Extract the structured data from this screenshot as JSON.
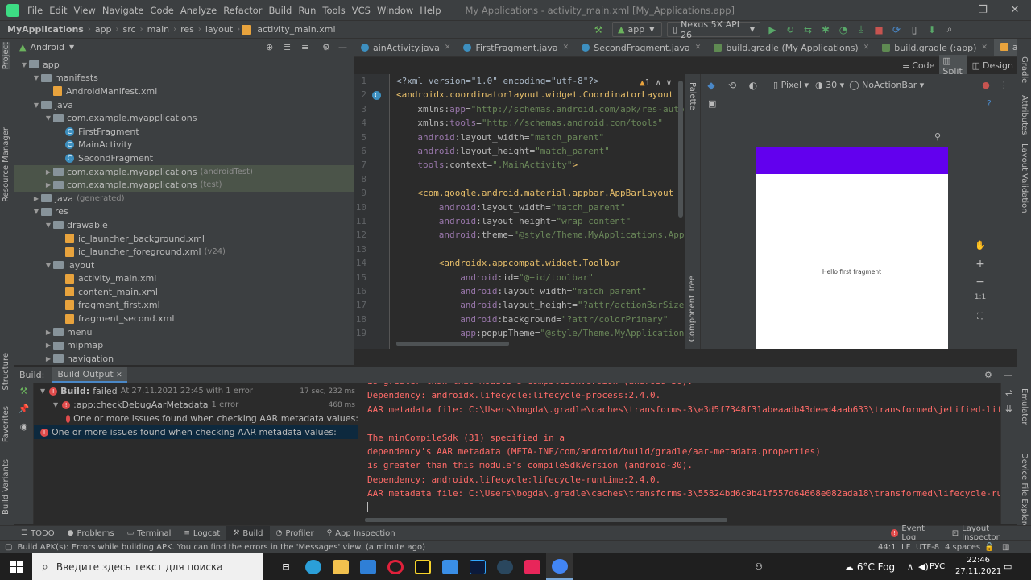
{
  "window": {
    "menu": [
      "File",
      "Edit",
      "View",
      "Navigate",
      "Code",
      "Analyze",
      "Refactor",
      "Build",
      "Run",
      "Tools",
      "VCS",
      "Window",
      "Help"
    ],
    "title": "My Applications - activity_main.xml [My_Applications.app]",
    "controls": {
      "minimize": "—",
      "maximize": "❐",
      "close": "✕"
    }
  },
  "navbar": {
    "breadcrumbs": [
      "MyApplications",
      "app",
      "src",
      "main",
      "res",
      "layout",
      "activity_main.xml"
    ],
    "run_config": "app",
    "device": "Nexus 5X API 26"
  },
  "project": {
    "view_label": "Android",
    "tree": [
      {
        "label": "app",
        "depth": 0,
        "kind": "folder",
        "open": true
      },
      {
        "label": "manifests",
        "depth": 1,
        "kind": "folder",
        "open": true
      },
      {
        "label": "AndroidManifest.xml",
        "depth": 2,
        "kind": "xml"
      },
      {
        "label": "java",
        "depth": 1,
        "kind": "folder",
        "open": true
      },
      {
        "label": "com.example.myapplications",
        "depth": 2,
        "kind": "folder",
        "open": true
      },
      {
        "label": "FirstFragment",
        "depth": 3,
        "kind": "class"
      },
      {
        "label": "MainActivity",
        "depth": 3,
        "kind": "class"
      },
      {
        "label": "SecondFragment",
        "depth": 3,
        "kind": "class"
      },
      {
        "label": "com.example.myapplications",
        "suffix": "(androidTest)",
        "depth": 2,
        "kind": "folder",
        "open": false,
        "hl": true
      },
      {
        "label": "com.example.myapplications",
        "suffix": "(test)",
        "depth": 2,
        "kind": "folder",
        "open": false,
        "hl": true
      },
      {
        "label": "java",
        "suffix": "(generated)",
        "depth": 1,
        "kind": "folder",
        "open": false
      },
      {
        "label": "res",
        "depth": 1,
        "kind": "folder",
        "open": true
      },
      {
        "label": "drawable",
        "depth": 2,
        "kind": "folder",
        "open": true
      },
      {
        "label": "ic_launcher_background.xml",
        "depth": 3,
        "kind": "xml"
      },
      {
        "label": "ic_launcher_foreground.xml",
        "suffix": "(v24)",
        "depth": 3,
        "kind": "xml"
      },
      {
        "label": "layout",
        "depth": 2,
        "kind": "folder",
        "open": true
      },
      {
        "label": "activity_main.xml",
        "depth": 3,
        "kind": "xml"
      },
      {
        "label": "content_main.xml",
        "depth": 3,
        "kind": "xml"
      },
      {
        "label": "fragment_first.xml",
        "depth": 3,
        "kind": "xml"
      },
      {
        "label": "fragment_second.xml",
        "depth": 3,
        "kind": "xml"
      },
      {
        "label": "menu",
        "depth": 2,
        "kind": "folder",
        "open": false
      },
      {
        "label": "mipmap",
        "depth": 2,
        "kind": "folder",
        "open": false
      },
      {
        "label": "navigation",
        "depth": 2,
        "kind": "folder",
        "open": false
      }
    ]
  },
  "editor": {
    "tabs": [
      {
        "label": "ainActivity.java",
        "icon": "class"
      },
      {
        "label": "FirstFragment.java",
        "icon": "class"
      },
      {
        "label": "SecondFragment.java",
        "icon": "class"
      },
      {
        "label": "build.gradle (My Applications)",
        "icon": "gradle"
      },
      {
        "label": "build.gradle (:app)",
        "icon": "gradle"
      },
      {
        "label": "activity_main.xml",
        "icon": "xml",
        "active": true
      },
      {
        "label": "con",
        "icon": "xml"
      }
    ],
    "view_modes": [
      "Code",
      "Split",
      "Design"
    ],
    "warning_count": "1",
    "lines": [
      {
        "n": "1",
        "indent": 0,
        "parts": [
          [
            "pl",
            "<?xml version=\"1.0\" encoding=\"utf-8\"?>"
          ]
        ]
      },
      {
        "n": "2",
        "indent": 0,
        "parts": [
          [
            "tag",
            "<androidx.coordinatorlayout.widget.CoordinatorLayout"
          ]
        ]
      },
      {
        "n": "3",
        "indent": 4,
        "parts": [
          [
            "attr",
            "xmlns:"
          ],
          [
            "ns",
            "app"
          ],
          [
            "attr",
            "="
          ],
          [
            "str",
            "\"http://schemas.android.com/apk/res-auto\""
          ]
        ]
      },
      {
        "n": "4",
        "indent": 4,
        "parts": [
          [
            "attr",
            "xmlns:"
          ],
          [
            "ns",
            "tools"
          ],
          [
            "attr",
            "="
          ],
          [
            "str",
            "\"http://schemas.android.com/tools\""
          ]
        ]
      },
      {
        "n": "5",
        "indent": 4,
        "parts": [
          [
            "ns",
            "android"
          ],
          [
            "attr",
            ":layout_width="
          ],
          [
            "str",
            "\"match_parent\""
          ]
        ]
      },
      {
        "n": "6",
        "indent": 4,
        "parts": [
          [
            "ns",
            "android"
          ],
          [
            "attr",
            ":layout_height="
          ],
          [
            "str",
            "\"match_parent\""
          ]
        ]
      },
      {
        "n": "7",
        "indent": 4,
        "parts": [
          [
            "ns",
            "tools"
          ],
          [
            "attr",
            ":context="
          ],
          [
            "str",
            "\".MainActivity\""
          ],
          [
            "tag",
            ">"
          ]
        ]
      },
      {
        "n": "8",
        "indent": 0,
        "parts": []
      },
      {
        "n": "9",
        "indent": 4,
        "parts": [
          [
            "tag",
            "<com.google.android.material.appbar.AppBarLayout"
          ]
        ]
      },
      {
        "n": "10",
        "indent": 8,
        "parts": [
          [
            "ns",
            "android"
          ],
          [
            "attr",
            ":layout_width="
          ],
          [
            "str",
            "\"match_parent\""
          ]
        ]
      },
      {
        "n": "11",
        "indent": 8,
        "parts": [
          [
            "ns",
            "android"
          ],
          [
            "attr",
            ":layout_height="
          ],
          [
            "str",
            "\"wrap_content\""
          ]
        ]
      },
      {
        "n": "12",
        "indent": 8,
        "parts": [
          [
            "ns",
            "android"
          ],
          [
            "attr",
            ":theme="
          ],
          [
            "str",
            "\"@style/Theme.MyApplications.AppBarOverlay\""
          ],
          [
            "tag",
            ">"
          ]
        ]
      },
      {
        "n": "13",
        "indent": 0,
        "parts": []
      },
      {
        "n": "14",
        "indent": 8,
        "parts": [
          [
            "tag",
            "<androidx.appcompat.widget.Toolbar"
          ]
        ]
      },
      {
        "n": "15",
        "indent": 12,
        "parts": [
          [
            "ns",
            "android"
          ],
          [
            "attr",
            ":id="
          ],
          [
            "str",
            "\"@+id/toolbar\""
          ]
        ]
      },
      {
        "n": "16",
        "indent": 12,
        "parts": [
          [
            "ns",
            "android"
          ],
          [
            "attr",
            ":layout_width="
          ],
          [
            "str",
            "\"match_parent\""
          ]
        ]
      },
      {
        "n": "17",
        "indent": 12,
        "parts": [
          [
            "ns",
            "android"
          ],
          [
            "attr",
            ":layout_height="
          ],
          [
            "str",
            "\"?attr/actionBarSize\""
          ]
        ]
      },
      {
        "n": "18",
        "indent": 12,
        "parts": [
          [
            "ns",
            "android"
          ],
          [
            "attr",
            ":background="
          ],
          [
            "str",
            "\"?attr/colorPrimary\""
          ]
        ]
      },
      {
        "n": "19",
        "indent": 12,
        "parts": [
          [
            "ns",
            "app"
          ],
          [
            "attr",
            ":popupTheme="
          ],
          [
            "str",
            "\"@style/Theme.MyApplications.PopupOverlay\""
          ]
        ]
      }
    ]
  },
  "design": {
    "device": "Pixel",
    "api": "30",
    "theme": "NoActionBar",
    "preview_text": "Hello first fragment",
    "palette_label": "Palette",
    "component_tree_label": "Component Tree",
    "appbar_color": "#6200ee"
  },
  "right_strip": [
    "Gradle",
    "Attributes",
    "Layout Validation",
    "Emulator",
    "Device File Explorer"
  ],
  "left_strip": [
    "Project",
    "Resource Manager",
    "Structure",
    "Favorites",
    "Build Variants"
  ],
  "build": {
    "label": "Build:",
    "tab": "Build Output",
    "tree": [
      {
        "text": "Build:",
        "status": "failed",
        "rest": "At 27.11.2021 22:45 with 1 error",
        "time": "17 sec, 232 ms",
        "depth": 0
      },
      {
        "text": ":app:checkDebugAarMetadata",
        "rest": "1 error",
        "time": "468 ms",
        "depth": 1
      },
      {
        "text": "One or more issues found when checking AAR metadata values:",
        "depth": 2
      },
      {
        "text": "One or more issues found when checking AAR metadata values:",
        "depth": 0,
        "selected": true
      }
    ],
    "output": [
      "is greater than this module's compileSdkVersion (android-30).",
      "Dependency: androidx.lifecycle:lifecycle-process:2.4.0.",
      "AAR metadata file: C:\\Users\\bogda\\.gradle\\caches\\transforms-3\\e3d5f7348f31abeaadb43deed4aab633\\transformed\\jetified-lifecycle-process-2.4.0\\META-INF\\com\\android\\build\\gradle\\aar-metadata.properties.",
      "",
      "The minCompileSdk (31) specified in a",
      "dependency's AAR metadata (META-INF/com/android/build/gradle/aar-metadata.properties)",
      "is greater than this module's compileSdkVersion (android-30).",
      "Dependency: androidx.lifecycle:lifecycle-runtime:2.4.0.",
      "AAR metadata file: C:\\Users\\bogda\\.gradle\\caches\\transforms-3\\55824bd6c9b41f557d64668e082ada18\\transformed\\lifecycle-runtime-2.4.0\\META-INF\\com\\android\\build\\gradle\\aar-metadata.properties."
    ]
  },
  "bottom_tabs": [
    "TODO",
    "Problems",
    "Terminal",
    "Logcat",
    "Build",
    "Profiler",
    "App Inspection"
  ],
  "bottom_tabs_right": [
    "Event Log",
    "Layout Inspector"
  ],
  "status": {
    "message": "Build APK(s): Errors while building APK. You can find the errors in the 'Messages' view. (a minute ago)",
    "position": "44:1",
    "line_sep": "LF",
    "encoding": "UTF-8",
    "indent": "4 spaces"
  },
  "taskbar": {
    "search_placeholder": "Введите здесь текст для поиска",
    "weather": "6°C Fog",
    "lang": "РУС",
    "time": "22:46",
    "date": "27.11.2021"
  }
}
